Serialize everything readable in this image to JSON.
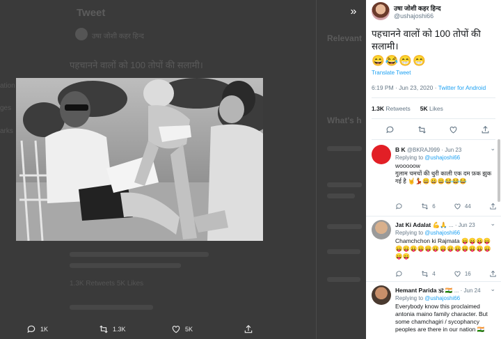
{
  "background": {
    "header_title": "Tweet",
    "author_name": "उषा जोशी कहर हिन्द",
    "tweet_text": "पहचानने वालों को 100 तोपों की सलामी।",
    "sidebar_title": "Relevant",
    "sidebar_title_2": "What's h",
    "stats_text": "1.3K Retweets   5K Likes",
    "left_nav": [
      "ation",
      "ges",
      "arks"
    ]
  },
  "modal": {
    "collapse_icon": "double-chevron-right-icon",
    "actions": {
      "reply_count": "1K",
      "retweet_count": "1.3K",
      "like_count": "5K"
    }
  },
  "tweet": {
    "author_name": "उषा जोशी कहर हिन्द",
    "author_handle": "@ushajoshi66",
    "text": "पहचानने वालों को 100 तोपों की सलामी।",
    "emoji": "😄😂😁😁",
    "translate_label": "Translate Tweet",
    "time": "6:19 PM · Jun 23, 2020 · ",
    "source": "Twitter for Android",
    "retweets_count": "1.3K",
    "retweets_label": "Retweets",
    "likes_count": "5K",
    "likes_label": "Likes"
  },
  "replies": [
    {
      "name": "B K",
      "handle": "@BKRAJ999",
      "date": "· Jun 23",
      "replying_to": "Replying to",
      "replying_handle": "@ushajoshi66",
      "text": "wooooow\nगुलाम चमचों की थुरी काली एक दम फ़क झुक गई है 🤘💃😀😀😀😂😂😂",
      "reply_count": "",
      "retweet_count": "6",
      "like_count": "44",
      "avatar_color": "#e21f26"
    },
    {
      "name": "Jat Ki Adalat 💪🙏",
      "handle": "...",
      "date": "· Jun 23",
      "replying_to": "Replying to",
      "replying_handle": "@ushajoshi66",
      "text": "Chamchchon ki Rajmata 😛😛😛😛😛😛😛😛😛😛😛😛😛😛😛😛😛😛😛",
      "reply_count": "",
      "retweet_count": "4",
      "like_count": "16",
      "avatar_color": "#b7b7b7"
    },
    {
      "name": "Hemant Parida 🕉 🇮🇳",
      "handle": "...",
      "date": "· Jun 24",
      "replying_to": "Replying to",
      "replying_handle": "@ushajoshi66",
      "text": "Everybody know this proclaimed antonia maino family character. But some chamchagiri / sycophancy peoples are there in our nation 🇮🇳",
      "reply_count": "",
      "retweet_count": "",
      "like_count": "",
      "avatar_color": "#8a5a44"
    }
  ]
}
